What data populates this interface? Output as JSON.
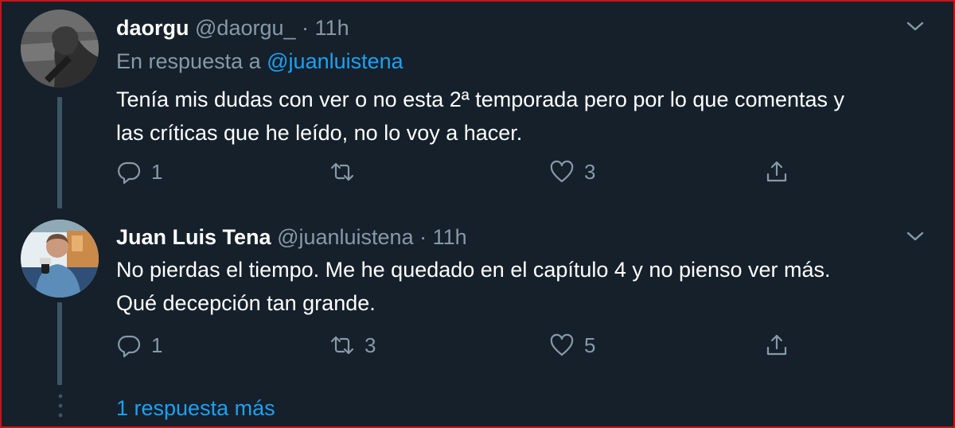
{
  "colors": {
    "background": "#15202b",
    "text_primary": "#ffffff",
    "text_secondary": "#8899a6",
    "accent": "#1da1f2",
    "thread_line": "#3d5466",
    "frame_border": "#c8131a"
  },
  "tweets": [
    {
      "display_name": "daorgu",
      "handle": "@daorgu_",
      "separator": "·",
      "time": "11h",
      "reply_prefix": "En respuesta a",
      "reply_handle": "@juanluistena",
      "text_lines": [
        "Tenía mis dudas con ver o no esta 2ª temporada pero por lo que comentas y",
        "las críticas que he leído, no lo voy a hacer."
      ],
      "replies": "1",
      "retweets": "",
      "likes": "3",
      "icons": {
        "reply": "reply-icon",
        "retweet": "retweet-icon",
        "like": "heart-icon",
        "share": "share-icon",
        "menu": "chevron-down-icon"
      }
    },
    {
      "display_name": "Juan Luis Tena",
      "handle": "@juanluistena",
      "separator": "·",
      "time": "11h",
      "text_lines": [
        "No pierdas el tiempo. Me he quedado en el capítulo 4 y no pienso ver más.",
        "Qué decepción tan grande."
      ],
      "replies": "1",
      "retweets": "3",
      "likes": "5",
      "icons": {
        "reply": "reply-icon",
        "retweet": "retweet-icon",
        "like": "heart-icon",
        "share": "share-icon",
        "menu": "chevron-down-icon"
      }
    }
  ],
  "more_replies_label": "1 respuesta más"
}
